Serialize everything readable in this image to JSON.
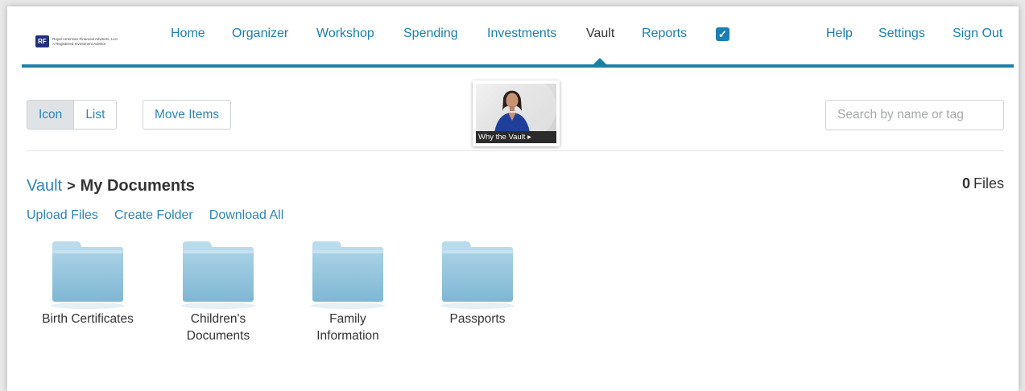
{
  "logo": {
    "mark": "RF",
    "line1": "Royal American Financial Advisors, LLC",
    "line2": "A Registered Investment Advisor"
  },
  "nav": {
    "items": [
      "Home",
      "Organizer",
      "Workshop",
      "Spending",
      "Investments",
      "Vault",
      "Reports"
    ],
    "active": "Vault",
    "right": [
      "Help",
      "Settings",
      "Sign Out"
    ]
  },
  "toolbar": {
    "view_icon_label": "Icon",
    "view_list_label": "List",
    "move_label": "Move Items",
    "video_caption": "Why the Vault ▸",
    "search_placeholder": "Search by name or tag"
  },
  "breadcrumb": {
    "root": "Vault",
    "separator": ">",
    "current": "My Documents"
  },
  "files_count": {
    "count": "0",
    "label": "Files"
  },
  "actions": [
    "Upload Files",
    "Create Folder",
    "Download All"
  ],
  "folders": [
    {
      "line1": "Birth Certificates",
      "line2": ""
    },
    {
      "line1": "Children's",
      "line2": "Documents"
    },
    {
      "line1": "Family",
      "line2": "Information"
    },
    {
      "line1": "Passports",
      "line2": ""
    }
  ],
  "colors": {
    "accent": "#1b80a6",
    "link": "#2e84b6",
    "folder": "#8fc3dd"
  }
}
